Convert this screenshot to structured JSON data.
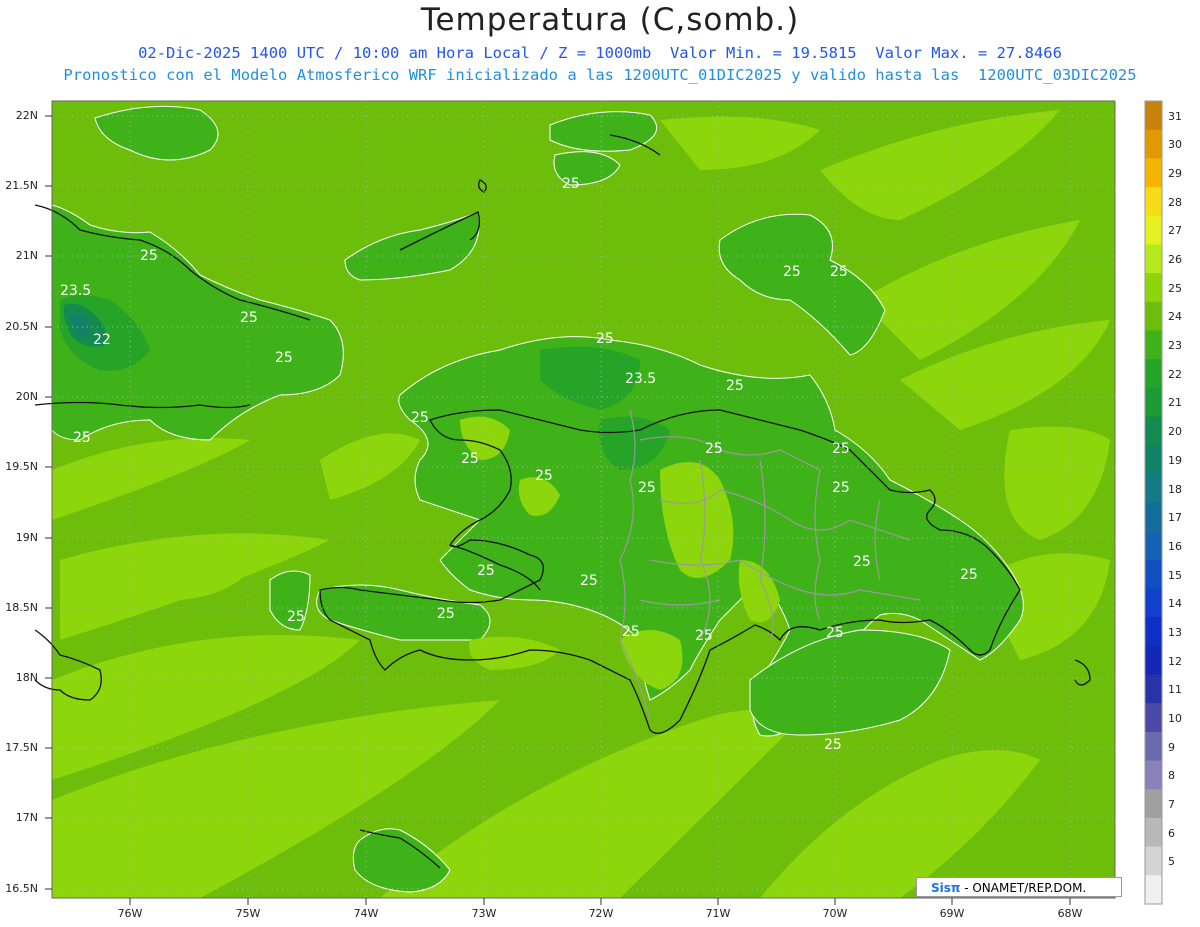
{
  "title": "Temperatura (C,somb.)",
  "subtitle1": "02-Dic-2025 1400 UTC / 10:00 am Hora Local / Z = 1000mb  Valor Min. = 19.5815  Valor Max. = 27.8466",
  "subtitle2": "Pronostico con el Modelo Atmosferico WRF inicializado a las 1200UTC_01DIC2025 y valido hasta las  1200UTC_03DIC2025",
  "lat_labels": [
    "22N",
    "21.5N",
    "21N",
    "20.5N",
    "20N",
    "19.5N",
    "19N",
    "18.5N",
    "18N",
    "17.5N",
    "17N",
    "16.5N"
  ],
  "lon_labels": [
    "76W",
    "75W",
    "74W",
    "73W",
    "72W",
    "71W",
    "70W",
    "69W",
    "68W"
  ],
  "colorbar": {
    "labels": [
      "31",
      "30",
      "29",
      "28",
      "27",
      "26",
      "25",
      "24",
      "23",
      "22",
      "21",
      "20",
      "19",
      "18",
      "17",
      "16",
      "15",
      "14",
      "13",
      "12",
      "11",
      "10",
      "9",
      "8",
      "7",
      "6",
      "5"
    ],
    "colors": [
      "#c8820a",
      "#e09a00",
      "#f4b400",
      "#f6dc14",
      "#e6f020",
      "#b4ea1e",
      "#8ed60c",
      "#6cbe0a",
      "#3fb21a",
      "#26a428",
      "#1c9a34",
      "#138a50",
      "#11826a",
      "#147a84",
      "#146e9c",
      "#1462b2",
      "#1250c2",
      "#1040cc",
      "#0e30c8",
      "#1428b8",
      "#2a32a8",
      "#4a4aa8",
      "#6a6aac",
      "#8a82b6",
      "#a0a0a0",
      "#b8b8b8",
      "#d4d4d4",
      "#f0f0f0"
    ]
  },
  "contour_labels": [
    "23.5",
    "22",
    "25",
    "25",
    "25",
    "25",
    "25",
    "25",
    "25",
    "25",
    "25",
    "23.5",
    "25",
    "25",
    "25",
    "25",
    "25",
    "25",
    "25",
    "25",
    "25",
    "25",
    "25",
    "25",
    "25",
    "25",
    "25",
    "25",
    "25"
  ],
  "credit": {
    "logo": "Sisπ",
    "text": " - ONAMET/REP.DOM."
  },
  "colors": {
    "sea": "#6cbe0a",
    "sea_light": "#8ed60c",
    "land_dark": "#3fb21a",
    "land_mid": "#26a428"
  }
}
